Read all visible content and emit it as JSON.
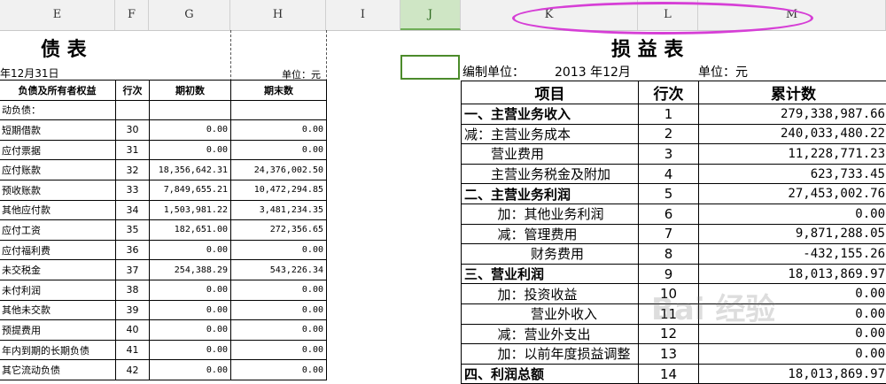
{
  "columns": [
    "E",
    "F",
    "G",
    "H",
    "I",
    "J",
    "K",
    "L",
    "M"
  ],
  "balance_sheet": {
    "title": "债      表",
    "date": "年12月31日",
    "unit": "单位：元",
    "headers": [
      "负债及所有者权益",
      "行次",
      "期初数",
      "期末数"
    ],
    "section": "动负债：",
    "rows": [
      {
        "name": "短期借款",
        "line": "30",
        "begin": "0.00",
        "end": "0.00"
      },
      {
        "name": "应付票据",
        "line": "31",
        "begin": "0.00",
        "end": "0.00"
      },
      {
        "name": "应付账款",
        "line": "32",
        "begin": "18,356,642.31",
        "end": "24,376,002.50"
      },
      {
        "name": "预收账款",
        "line": "33",
        "begin": "7,849,655.21",
        "end": "10,472,294.85"
      },
      {
        "name": "其他应付款",
        "line": "34",
        "begin": "1,503,981.22",
        "end": "3,481,234.35"
      },
      {
        "name": "应付工资",
        "line": "35",
        "begin": "182,651.00",
        "end": "272,356.65"
      },
      {
        "name": "应付福利费",
        "line": "36",
        "begin": "0.00",
        "end": "0.00"
      },
      {
        "name": "未交税金",
        "line": "37",
        "begin": "254,388.29",
        "end": "543,226.34"
      },
      {
        "name": "未付利润",
        "line": "38",
        "begin": "0.00",
        "end": "0.00"
      },
      {
        "name": "其他未交款",
        "line": "39",
        "begin": "0.00",
        "end": "0.00"
      },
      {
        "name": "预提费用",
        "line": "40",
        "begin": "0.00",
        "end": "0.00"
      },
      {
        "name": "年内到期的长期负债",
        "line": "41",
        "begin": "0.00",
        "end": "0.00"
      },
      {
        "name": "其它流动负债",
        "line": "42",
        "begin": "0.00",
        "end": "0.00"
      }
    ]
  },
  "income_statement": {
    "title": "损   益   表",
    "org_label": "编制单位：",
    "period": "2013 年12月",
    "unit": "单位：元",
    "headers": [
      "项目",
      "行次",
      "累计数"
    ],
    "rows": [
      {
        "name": "一、主营业务收入",
        "line": "1",
        "value": "279,338,987.66",
        "bold": true,
        "indent": 0
      },
      {
        "name": "减：主营业务成本",
        "line": "2",
        "value": "240,033,480.22",
        "bold": false,
        "indent": 0
      },
      {
        "name": "营业费用",
        "line": "3",
        "value": "11,228,771.23",
        "bold": false,
        "indent": 2
      },
      {
        "name": "主营业务税金及附加",
        "line": "4",
        "value": "623,733.45",
        "bold": false,
        "indent": 2
      },
      {
        "name": "二、主营业务利润",
        "line": "5",
        "value": "27,453,002.76",
        "bold": true,
        "indent": 0
      },
      {
        "name": "加：其他业务利润",
        "line": "6",
        "value": "0.00",
        "bold": false,
        "indent": 2.5
      },
      {
        "name": "减：管理费用",
        "line": "7",
        "value": "9,871,288.05",
        "bold": false,
        "indent": 2.5
      },
      {
        "name": "财务费用",
        "line": "8",
        "value": "-432,155.26",
        "bold": false,
        "indent": 5
      },
      {
        "name": "三、营业利润",
        "line": "9",
        "value": "18,013,869.97",
        "bold": true,
        "indent": 0
      },
      {
        "name": "加：投资收益",
        "line": "10",
        "value": "0.00",
        "bold": false,
        "indent": 2.5
      },
      {
        "name": "营业外收入",
        "line": "11",
        "value": "0.00",
        "bold": false,
        "indent": 5
      },
      {
        "name": "减：营业外支出",
        "line": "12",
        "value": "0.00",
        "bold": false,
        "indent": 2.5
      },
      {
        "name": "加：以前年度损益调整",
        "line": "13",
        "value": "0.00",
        "bold": false,
        "indent": 2.5
      },
      {
        "name": "四、利润总额",
        "line": "14",
        "value": "18,013,869.97",
        "bold": true,
        "indent": 0
      }
    ]
  },
  "watermark": "Bai 经验"
}
